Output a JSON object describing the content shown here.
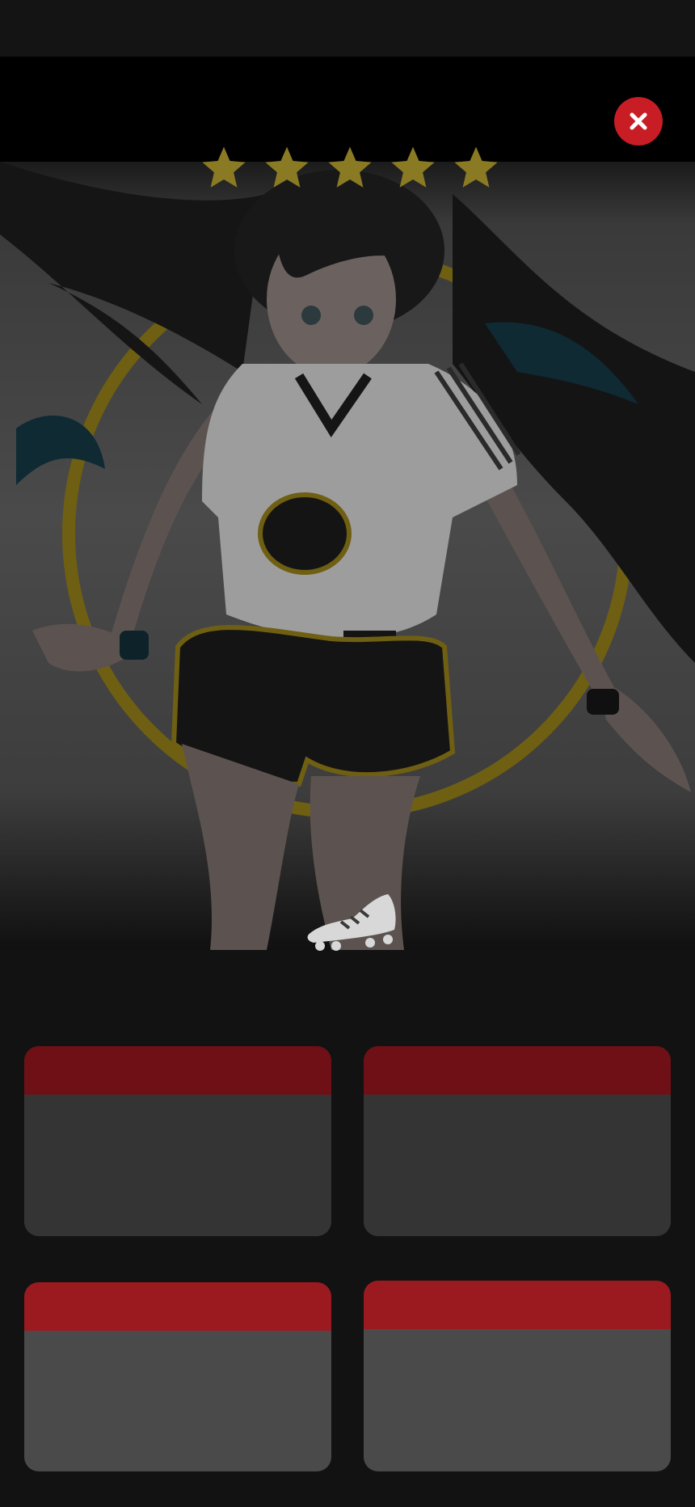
{
  "overlay": {
    "star_rating": 5,
    "star_max": 5,
    "close_icon": "close-icon",
    "shoe_icon": "football-boot-icon"
  },
  "colors": {
    "accent_red": "#c81d25",
    "card_head_dark": "#6e1015",
    "card_head_bright": "#9a1a20",
    "star_gold": "#8a7a23",
    "ring_gold": "#6f5f12"
  },
  "cards": [
    {
      "id": 1
    },
    {
      "id": 2
    },
    {
      "id": 3
    },
    {
      "id": 4
    }
  ]
}
